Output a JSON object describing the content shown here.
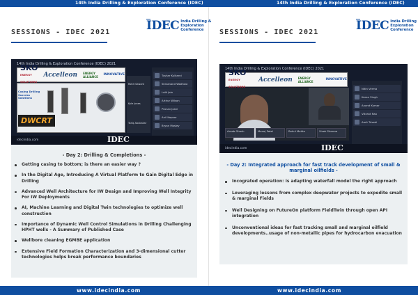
{
  "header": {
    "left": "14th India Drilling & Exploration Conference (IDEC)",
    "right": "14th India Drilling & Exploration Conference (IDEC)"
  },
  "footer": {
    "left": "www.idecindia.com",
    "right": "www.idecindia.com"
  },
  "logo": {
    "mark": "IDEC",
    "line1": "India Drilling &",
    "line2": "Exploration Conference"
  },
  "pages": [
    {
      "section_title": "SESSIONS - IDEC 2021",
      "screenshot": {
        "title": "14th India Drilling & Exploration Conference (IDEC) 2021",
        "sponsor1": "SKO",
        "sponsor1_sub": "ENERGY SOLUTIONS",
        "sponsor2": "Accelleon",
        "sponsor3": "ENERGY ALLIANCE",
        "sponsor4": "INNOVATIVE",
        "promo_text": "Casing Drilling Success Solutions",
        "product_name": "DWCRT",
        "product_name_a": "DW",
        "product_name_b": "CRT",
        "watermark": "idecindia.com",
        "mid_labels": [
          "Rohit Sawant",
          "Kyle Jones",
          "Tariq Abubakar"
        ],
        "attendees": [
          "Tushar Kulkarni",
          "Shivanand Wadhwa",
          "Lalit Jain",
          "Arthur Wilson",
          "Pranav Joshi",
          "Anil Kapoor",
          "Bryan Mosley"
        ]
      },
      "day_title": "- Day 2: Drilling & Completions -",
      "bullets": [
        "Getting casing to bottom; is there an easier way ?",
        "In the Digital Age, Introducing A Virtual Platform to Gain Digital Edge in Drilling",
        "Advanced Well Architecture for IW Design and Improving Well Integrity For IW Deployments",
        "AI, Machine Learning and Digital Twin technologies to optimize well construction",
        "Importance of Dynamic Well Control Simulations in Drilling Challenging HPHT wells - A Summary of Published Case",
        "Wellbore cleaning EGMBE application",
        "Extensive Field Formation Characterization and 3-dimensional cutter technologies helps break performance boundaries"
      ]
    },
    {
      "section_title": "SESSIONS - IDEC 2021",
      "screenshot": {
        "title": "14th India Drilling & Exploration Conference (IDEC) 2021",
        "sponsor1": "SKO",
        "sponsor1_sub": "ENERGY SOLUTIONS",
        "sponsor2": "Accelleon",
        "sponsor3": "ENERGY ALLIANCE",
        "sponsor4": "INNOVATIVE",
        "watermark": "idecindia.com",
        "tiles": [
          "Arnab Ghosh",
          "Manoj Patel",
          "Rahul Mehta",
          "Vivek Sharma"
        ],
        "attendees": [
          "Nitin Verma",
          "Karan Singh",
          "Anand Kumar",
          "Vikrant Rao",
          "Amit Trivedi"
        ]
      },
      "day_title": "- Day 2: Integrated approach for fast track development of small & marginal oilfields -",
      "bullets": [
        "Incograted operation: is adapting waterfall model the right approach",
        "Leveraging lessons from complex deepwater projects to expedite small & marginal Fields",
        "Well Designing on FutureOn platform FieldTwin through open API integration",
        "Unconventional ideas for fast tracking small and marginal oilfield developments..usage of non-metallic pipes for hydrocarbon evacuation"
      ]
    }
  ]
}
